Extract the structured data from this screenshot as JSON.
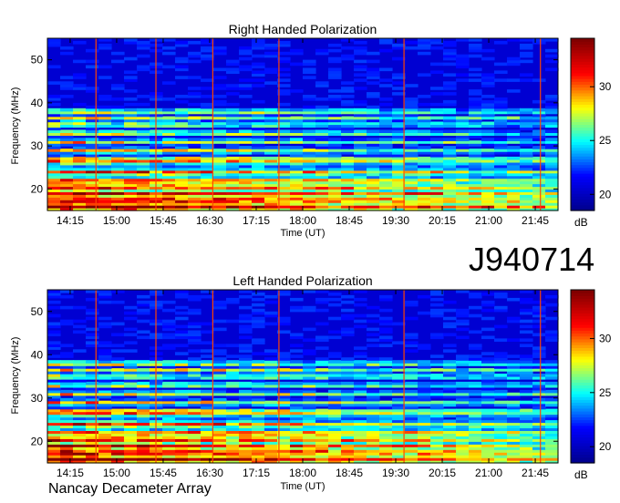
{
  "chart_data": [
    {
      "type": "heatmap",
      "title": "Right Handed Polarization",
      "xlabel": "Time (UT)",
      "ylabel": "Frequency (MHz)",
      "x_ticks": [
        "14:15",
        "15:00",
        "15:45",
        "16:30",
        "17:15",
        "18:00",
        "18:45",
        "19:30",
        "20:15",
        "21:00",
        "21:45"
      ],
      "y_ticks": [
        20,
        30,
        40,
        50
      ],
      "ylim": [
        15,
        55
      ],
      "colorbar": {
        "label": "dB",
        "ticks": [
          20,
          25,
          30
        ],
        "range": [
          18.5,
          34.5
        ]
      },
      "bright_bands_mhz": [
        16,
        17.5,
        19,
        20.5,
        22,
        24,
        26.5,
        27,
        29,
        31,
        33,
        35,
        36.5,
        38
      ],
      "vertical_lines_time": [
        "14:40",
        "15:38",
        "16:33",
        "17:37",
        "19:38",
        "21:50"
      ]
    },
    {
      "type": "heatmap",
      "title": "Left Handed Polarization",
      "xlabel": "Time (UT)",
      "ylabel": "Frequency (MHz)",
      "x_ticks": [
        "14:15",
        "15:00",
        "15:45",
        "16:30",
        "17:15",
        "18:00",
        "18:45",
        "19:30",
        "20:15",
        "21:00",
        "21:45"
      ],
      "y_ticks": [
        20,
        30,
        40,
        50
      ],
      "ylim": [
        15,
        55
      ],
      "colorbar": {
        "label": "dB",
        "ticks": [
          20,
          25,
          30
        ],
        "range": [
          18.5,
          34.5
        ]
      },
      "bright_bands_mhz": [
        16,
        17.5,
        19,
        20.5,
        22,
        24,
        26.5,
        27,
        29,
        31,
        33,
        35,
        36.5,
        38
      ],
      "vertical_lines_time": [
        "14:40",
        "15:38",
        "16:33",
        "17:37",
        "19:38",
        "21:50"
      ]
    }
  ],
  "observation_id": "J940714",
  "observatory": "Nancay Decameter Array",
  "colormap": [
    "#00008f",
    "#0000ff",
    "#00ffff",
    "#ffff00",
    "#ff0000",
    "#800000"
  ]
}
